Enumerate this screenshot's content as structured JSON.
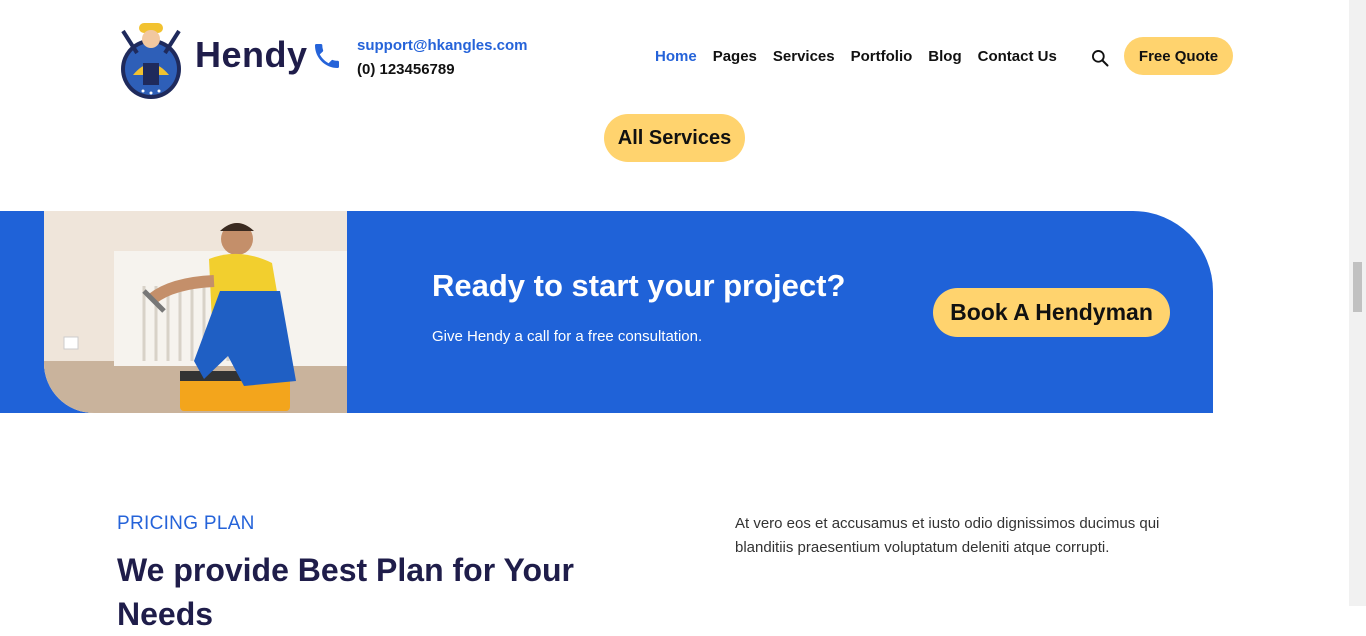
{
  "header": {
    "brand": "Hendy",
    "email": "support@hkangles.com",
    "phone": "(0) 123456789",
    "nav": [
      "Home",
      "Pages",
      "Services",
      "Portfolio",
      "Blog",
      "Contact Us"
    ],
    "active_nav": "Home",
    "cta": "Free Quote"
  },
  "services": {
    "all_services_label": "All Services"
  },
  "banner": {
    "title": "Ready to start your project?",
    "subtitle": "Give Hendy a call for a free consultation.",
    "cta": "Book A Hendyman"
  },
  "pricing": {
    "kicker": "PRICING PLAN",
    "title": "We provide Best Plan for Your Needs",
    "description": "At vero eos et accusamus et iusto odio dignissimos ducimus qui blanditiis praesentium voluptatum deleniti atque corrupti."
  },
  "colors": {
    "accent": "#2563d9",
    "banner_bg": "#1f62d8",
    "button_yellow": "#ffd36e",
    "heading": "#1f1d4a"
  },
  "icons": [
    "hendy-logo",
    "phone-icon",
    "search-icon"
  ]
}
